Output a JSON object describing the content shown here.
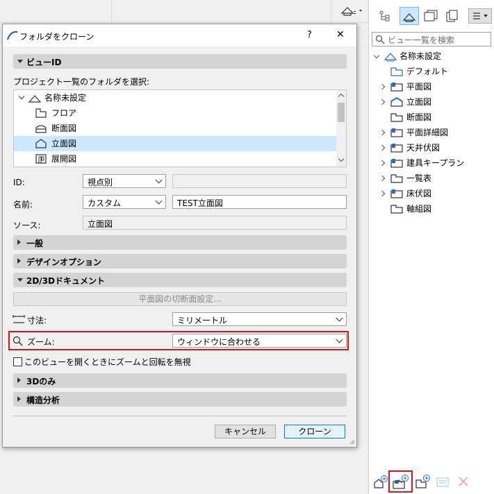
{
  "dialog": {
    "title": "フォルダをクローン",
    "help": "?",
    "close": "✕",
    "section_viewid": "ビューID",
    "select_label": "プロジェクト一覧のフォルダを選択:",
    "tree": [
      {
        "label": "名称未設定",
        "icon": "house-icon"
      },
      {
        "label": "フロア",
        "icon": "floor-icon"
      },
      {
        "label": "断面図",
        "icon": "section-icon"
      },
      {
        "label": "立面図",
        "icon": "elevation-icon"
      },
      {
        "label": "展開図",
        "icon": "interior-elevation-icon"
      }
    ],
    "id_label": "ID:",
    "id_value": "視点別",
    "id_text": "",
    "name_label": "名前:",
    "name_value": "カスタム",
    "name_text": "TEST立面図",
    "source_label": "ソース:",
    "source_value": "立面図",
    "section_general": "一般",
    "section_design": "デザインオプション",
    "section_2d3d": "2D/3Dドキュメント",
    "cut_plane_button": "平面図の切断面設定...",
    "dim_label": "寸法:",
    "dim_value": "ミリメートル",
    "zoom_label": "ズーム:",
    "zoom_value": "ウィンドウに合わせる",
    "ignore_zoom": "このビューを開くときにズームと回転を無視",
    "section_3d": "3Dのみ",
    "section_struct": "構造分析",
    "cancel": "キャンセル",
    "clone": "クローン"
  },
  "panel": {
    "search_placeholder": "ビュー一覧を検索",
    "items": [
      {
        "label": "名称未設定",
        "level": 0,
        "expanded": true,
        "icon": "house-icon"
      },
      {
        "label": "デフォルト",
        "level": 1,
        "expander": false,
        "icon": "folder-icon"
      },
      {
        "label": "平面図",
        "level": 1,
        "expander": true,
        "icon": "floor-folder-icon"
      },
      {
        "label": "立面図",
        "level": 1,
        "expander": true,
        "icon": "elevation-folder-icon"
      },
      {
        "label": "断面図",
        "level": 1,
        "expander": false,
        "icon": "folder-icon"
      },
      {
        "label": "平面詳細図",
        "level": 1,
        "expander": true,
        "icon": "floor-folder-icon"
      },
      {
        "label": "天井伏図",
        "level": 1,
        "expander": true,
        "icon": "floor-folder-icon"
      },
      {
        "label": "建具キープラン",
        "level": 1,
        "expander": true,
        "icon": "floor-folder-icon"
      },
      {
        "label": "一覧表",
        "level": 1,
        "expander": true,
        "icon": "folder-icon"
      },
      {
        "label": "床伏図",
        "level": 1,
        "expander": true,
        "icon": "floor-folder-icon"
      },
      {
        "label": "軸組図",
        "level": 1,
        "expander": false,
        "icon": "folder-icon"
      }
    ]
  },
  "colors": {
    "highlight": "#e0101a",
    "selection": "#cce8ff",
    "accent": "#0078d7"
  }
}
